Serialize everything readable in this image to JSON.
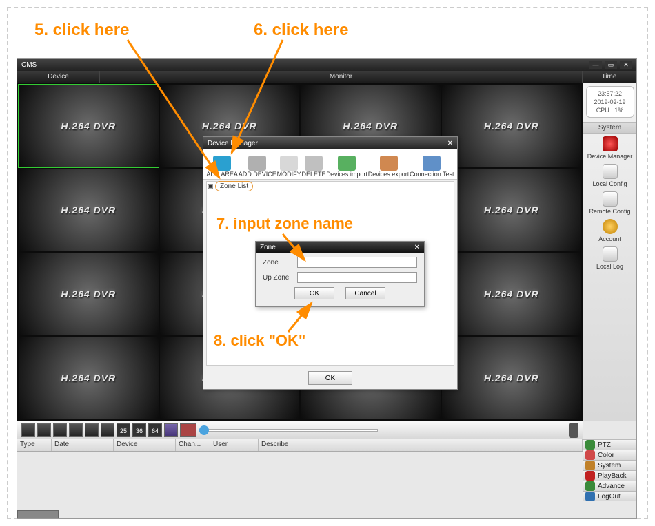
{
  "annotations": {
    "step5": "5. click here",
    "step6": "6. click here",
    "step7": "7. input zone name",
    "step8": "8. click \"OK\""
  },
  "app": {
    "title": "CMS",
    "header": {
      "device": "Device",
      "monitor": "Monitor",
      "time": "Time"
    }
  },
  "clock": {
    "time": "23:57:22",
    "date": "2019-02-19",
    "cpu": "CPU : 1%"
  },
  "sidebar": {
    "system_header": "System",
    "items": [
      {
        "label": "Device Manager"
      },
      {
        "label": "Local Config"
      },
      {
        "label": "Remote Config"
      },
      {
        "label": "Account"
      },
      {
        "label": "Local Log"
      }
    ]
  },
  "grid": {
    "tile_text": "H.264 DVR",
    "num25": "25",
    "num36": "36",
    "num64": "64"
  },
  "log": {
    "cols": {
      "type": "Type",
      "date": "Date",
      "device": "Device",
      "chan": "Chan...",
      "user": "User",
      "describe": "Describe"
    }
  },
  "funcs": [
    {
      "label": "PTZ",
      "color": "#3a8a3a"
    },
    {
      "label": "Color",
      "color": "#d04848"
    },
    {
      "label": "System",
      "color": "#c08028"
    },
    {
      "label": "PlayBack",
      "color": "#c02020"
    },
    {
      "label": "Advance",
      "color": "#3a8a3a"
    },
    {
      "label": "LogOut",
      "color": "#3070b0"
    }
  ],
  "dm": {
    "title": "Device Manager",
    "tools": [
      {
        "label": "ADD AREA",
        "color": "#2aa0d0"
      },
      {
        "label": "ADD DEVICE",
        "color": "#b0b0b0"
      },
      {
        "label": "MODIFY",
        "color": "#d8d8d8"
      },
      {
        "label": "DELETE",
        "color": "#c0c0c0"
      },
      {
        "label": "Devices import",
        "color": "#58b060"
      },
      {
        "label": "Devices export",
        "color": "#d08850"
      },
      {
        "label": "Connection Test",
        "color": "#6090c8"
      }
    ],
    "tree_root": "Zone List",
    "ok": "OK"
  },
  "zone": {
    "title": "Zone",
    "label_zone": "Zone",
    "label_upzone": "Up Zone",
    "value_zone": "",
    "value_upzone": "",
    "ok": "OK",
    "cancel": "Cancel"
  }
}
